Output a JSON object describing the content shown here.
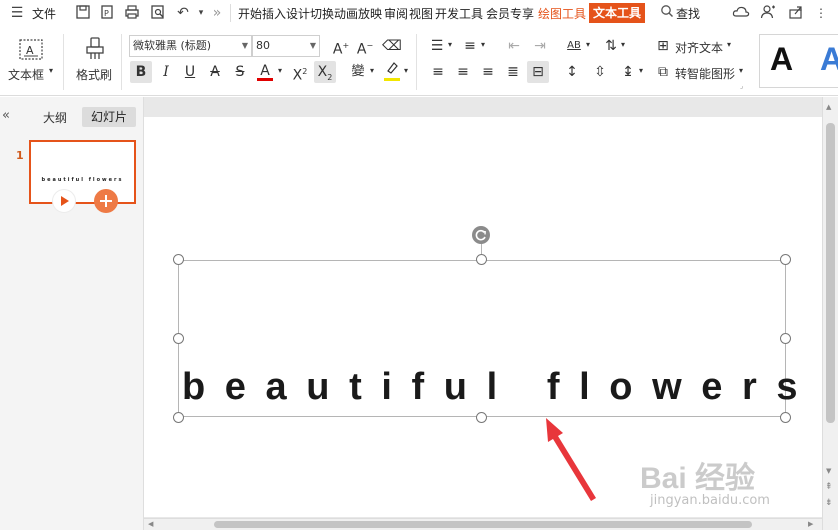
{
  "menubar": {
    "file_label": "文件",
    "tabs": [
      "开始",
      "插入",
      "设计",
      "切换",
      "动画",
      "放映",
      "审阅",
      "视图",
      "开发工具",
      "会员专享"
    ],
    "draw_tools": "绘图工具",
    "text_tools": "文本工具",
    "search_label": "查找"
  },
  "ribbon": {
    "textbox_label": "文本框",
    "format_painter_label": "格式刷",
    "font_name": "微软雅黑 (标题)",
    "font_size": "80",
    "align_text_label": "对齐文本",
    "smartart_label": "转智能图形",
    "style_sample": "A"
  },
  "leftpanel": {
    "tab_outline": "大纲",
    "tab_slides": "幻灯片",
    "slide_number": "1",
    "thumb_text": "beautiful flowers"
  },
  "slide": {
    "text": "beautiful flowers"
  },
  "watermark": {
    "brand": "Bai 经验",
    "url": "jingyan.baidu.com"
  },
  "colors": {
    "accent": "#e5531a",
    "arrow": "#e8363b",
    "font_color_bar": "#e00000",
    "highlight_bar": "#f2e600"
  },
  "icons": [
    "menu-icon",
    "save-icon",
    "export-icon",
    "print-icon",
    "preview-icon",
    "undo-icon",
    "more-icon",
    "search-icon",
    "cloud-icon",
    "share-icon",
    "user-icon",
    "collapse-icon",
    "play-icon",
    "add-icon",
    "rotate-icon"
  ]
}
